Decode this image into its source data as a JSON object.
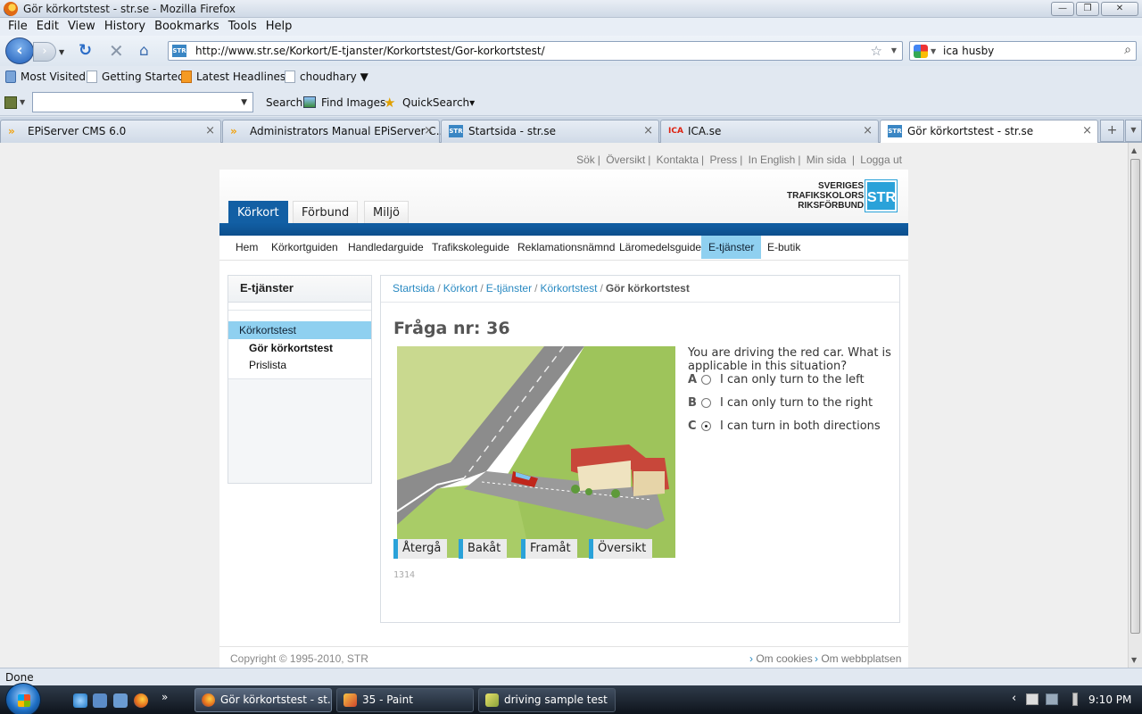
{
  "window": {
    "title": "Gör körkortstest - str.se - Mozilla Firefox"
  },
  "menubar": [
    "File",
    "Edit",
    "View",
    "History",
    "Bookmarks",
    "Tools",
    "Help"
  ],
  "navbar": {
    "url": "http://www.str.se/Korkort/E-tjanster/Korkortstest/Gor-korkortstest/",
    "site_icon": "STR",
    "search_query": "ica husby"
  },
  "bookmarks": [
    "Most Visited",
    "Getting Started",
    "Latest Headlines",
    "choudhary ▼"
  ],
  "toolrow": {
    "search_label": "Search",
    "find_images_label": "Find Images",
    "quicksearch_label": "QuickSearch▾"
  },
  "tabs": [
    {
      "label": "EPiServer CMS 6.0",
      "icon": "»"
    },
    {
      "label": "Administrators Manual EPiServer C...",
      "icon": "»"
    },
    {
      "label": "Startsida - str.se",
      "icon": "STR"
    },
    {
      "label": "ICA.se",
      "icon": "ICA"
    },
    {
      "label": "Gör körkortstest - str.se",
      "icon": "STR"
    }
  ],
  "page": {
    "top_links": [
      "Sök",
      "Översikt",
      "Kontakta",
      "Press",
      "In English",
      "Min sida",
      "Logga ut"
    ],
    "logo": {
      "line1": "SVERIGES",
      "line2": "TRAFIKSKOLORS",
      "line3": "RIKSFÖRBUND",
      "mark": "STR"
    },
    "main_tabs": [
      "Körkort",
      "Förbund",
      "Miljö"
    ],
    "subnav": [
      "Hem",
      "Körkortguiden",
      "Handledarguide",
      "Trafikskoleguide",
      "Reklamationsnämnd",
      "Läromedelsguide",
      "E-tjänster",
      "E-butik"
    ],
    "sidebar": {
      "heading": "E-tjänster",
      "section": "Körkortstest",
      "items": [
        "Gör körkortstest",
        "Prislista"
      ]
    },
    "breadcrumb": [
      "Startsida",
      "Körkort",
      "E-tjänster",
      "Körkortstest",
      "Gör körkortstest"
    ],
    "question": {
      "title": "Fråga nr: 36",
      "text": "You are driving the red car. What is applicable in this situation?",
      "options": [
        {
          "letter": "A",
          "text": "I can only turn to the left",
          "selected": false
        },
        {
          "letter": "B",
          "text": "I can only turn to the right",
          "selected": false
        },
        {
          "letter": "C",
          "text": "I can turn in both directions",
          "selected": true
        }
      ],
      "buttons": [
        "Återgå",
        "Bakåt",
        "Framåt",
        "Översikt"
      ],
      "id": "1314"
    },
    "footer": {
      "copyright": "Copyright © 1995-2010, STR",
      "links": [
        "Om cookies",
        "Om webbplatsen"
      ]
    }
  },
  "status": "Done",
  "taskbar": {
    "buttons": [
      "Gör körkortstest - st...",
      "35 - Paint",
      "driving sample test"
    ],
    "clock": "9:10 PM",
    "more": "»"
  }
}
